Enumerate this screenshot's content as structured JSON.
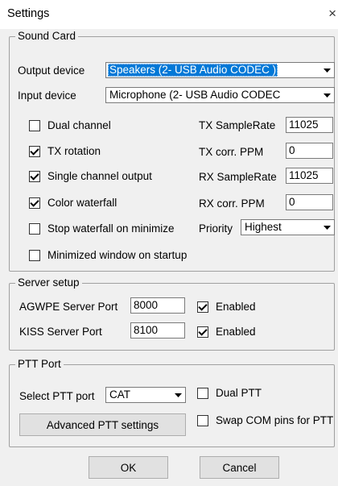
{
  "window": {
    "title": "Settings",
    "close_glyph": "×"
  },
  "sound_card": {
    "legend": "Sound Card",
    "output_device_label": "Output device",
    "output_device_value": "Speakers (2- USB Audio CODEC )",
    "input_device_label": "Input device",
    "input_device_value": "Microphone (2- USB Audio CODEC",
    "checkboxes": [
      {
        "label": "Dual channel",
        "checked": false
      },
      {
        "label": "TX rotation",
        "checked": true
      },
      {
        "label": "Single channel output",
        "checked": true
      },
      {
        "label": "Color waterfall",
        "checked": true
      },
      {
        "label": "Stop waterfall on minimize",
        "checked": false
      },
      {
        "label": "Minimized window on startup",
        "checked": false
      }
    ],
    "tx_samplerate_label": "TX SampleRate",
    "tx_samplerate_value": "11025",
    "tx_corr_label": "TX corr. PPM",
    "tx_corr_value": "0",
    "rx_samplerate_label": "RX SampleRate",
    "rx_samplerate_value": "11025",
    "rx_corr_label": "RX corr. PPM",
    "rx_corr_value": "0",
    "priority_label": "Priority",
    "priority_value": "Highest"
  },
  "server_setup": {
    "legend": "Server setup",
    "agwpe_label": "AGWPE Server Port",
    "agwpe_port": "8000",
    "agwpe_enabled_label": "Enabled",
    "agwpe_enabled": true,
    "kiss_label": "KISS Server Port",
    "kiss_port": "8100",
    "kiss_enabled_label": "Enabled",
    "kiss_enabled": true
  },
  "ptt_port": {
    "legend": "PTT Port",
    "select_label": "Select PTT port",
    "select_value": "CAT",
    "dual_ptt_label": "Dual PTT",
    "dual_ptt": false,
    "swap_com_label": "Swap COM pins for PTT",
    "swap_com": false,
    "advanced_button": "Advanced PTT settings"
  },
  "buttons": {
    "ok": "OK",
    "cancel": "Cancel"
  }
}
